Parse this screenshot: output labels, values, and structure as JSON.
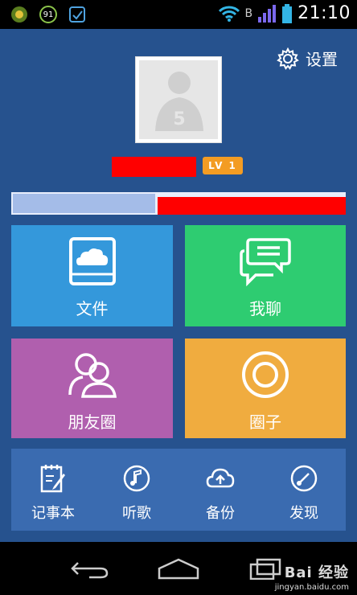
{
  "statusbar": {
    "time": "21:10",
    "notif_icons": [
      "game-icon",
      "badge-91-icon",
      "check-app-icon"
    ],
    "notif_91_text": "91",
    "network_letter": "B"
  },
  "profile": {
    "settings_label": "设置",
    "level_badge": "LV 1",
    "progress_fraction": 0.43
  },
  "tiles": [
    {
      "label": "文件",
      "color": "#3498db",
      "icon": "cloud-folder-icon"
    },
    {
      "label": "我聊",
      "color": "#2ecc71",
      "icon": "chat-bubbles-icon"
    },
    {
      "label": "朋友圈",
      "color": "#b05fae",
      "icon": "friends-icon"
    },
    {
      "label": "圈子",
      "color": "#f0ac3f",
      "icon": "circle-ring-icon"
    }
  ],
  "tools": [
    {
      "label": "记事本",
      "icon": "notepad-icon"
    },
    {
      "label": "听歌",
      "icon": "music-disc-icon"
    },
    {
      "label": "备份",
      "icon": "cloud-upload-icon"
    },
    {
      "label": "发现",
      "icon": "compass-icon"
    }
  ],
  "watermark": {
    "logo": "Bai 经验",
    "url": "jingyan.baidu.com"
  }
}
